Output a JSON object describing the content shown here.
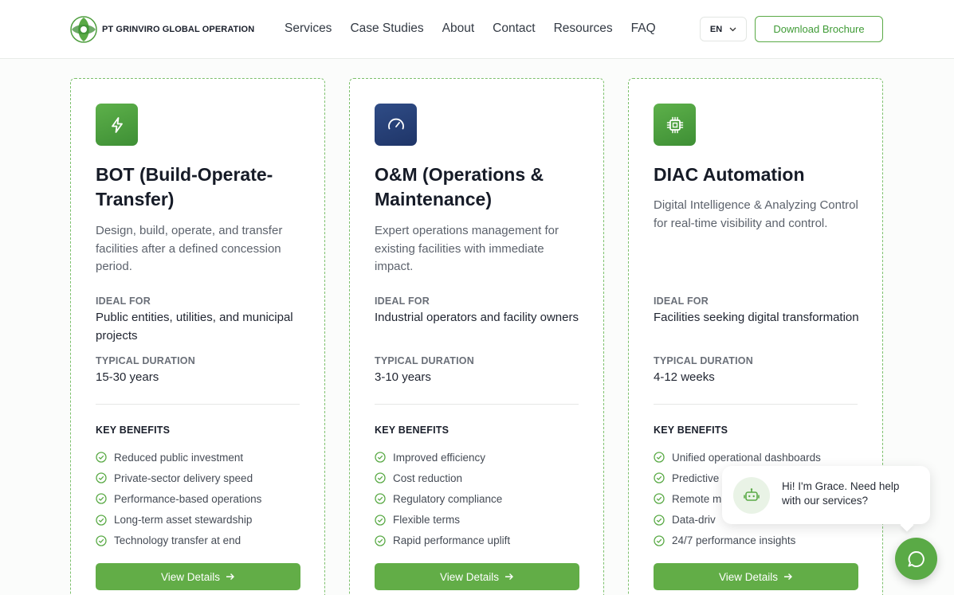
{
  "header": {
    "logo_text": "PT GRINVIRO GLOBAL OPERATION",
    "nav": [
      "Services",
      "Case Studies",
      "About",
      "Contact",
      "Resources",
      "FAQ"
    ],
    "language": "EN",
    "brochure_label": "Download Brochure"
  },
  "cards": [
    {
      "icon": "lightning-icon",
      "title": "BOT (Build-Operate-Transfer)",
      "description": "Design, build, operate, and transfer facilities after a defined concession period.",
      "ideal_for_label": "IDEAL FOR",
      "ideal_for": "Public entities, utilities, and municipal projects",
      "duration_label": "TYPICAL DURATION",
      "duration": "15-30 years",
      "benefits_label": "KEY BENEFITS",
      "benefits": [
        "Reduced public investment",
        "Private-sector delivery speed",
        "Performance-based operations",
        "Long-term asset stewardship",
        "Technology transfer at end"
      ],
      "button": "View Details"
    },
    {
      "icon": "gauge-icon",
      "title": "O&M (Operations & Maintenance)",
      "description": "Expert operations management for existing facilities with immediate impact.",
      "ideal_for_label": "IDEAL FOR",
      "ideal_for": "Industrial operators and facility owners",
      "duration_label": "TYPICAL DURATION",
      "duration": "3-10 years",
      "benefits_label": "KEY BENEFITS",
      "benefits": [
        "Improved efficiency",
        "Cost reduction",
        "Regulatory compliance",
        "Flexible terms",
        "Rapid performance uplift"
      ],
      "button": "View Details"
    },
    {
      "icon": "chip-icon",
      "title": "DIAC Automation",
      "description": "Digital Intelligence & Analyzing Control for real-time visibility and control.",
      "ideal_for_label": "IDEAL FOR",
      "ideal_for": "Facilities seeking digital transformation",
      "duration_label": "TYPICAL DURATION",
      "duration": "4-12 weeks",
      "benefits_label": "KEY BENEFITS",
      "benefits": [
        "Unified operational dashboards",
        "Predictive",
        "Remote m",
        "Data-driv",
        "24/7 performance insights"
      ],
      "button": "View Details"
    }
  ],
  "chat": {
    "message": "Hi! I'm Grace. Need help with our services?"
  },
  "colors": {
    "brand_green": "#5aaa46",
    "navy": "#243d75"
  }
}
